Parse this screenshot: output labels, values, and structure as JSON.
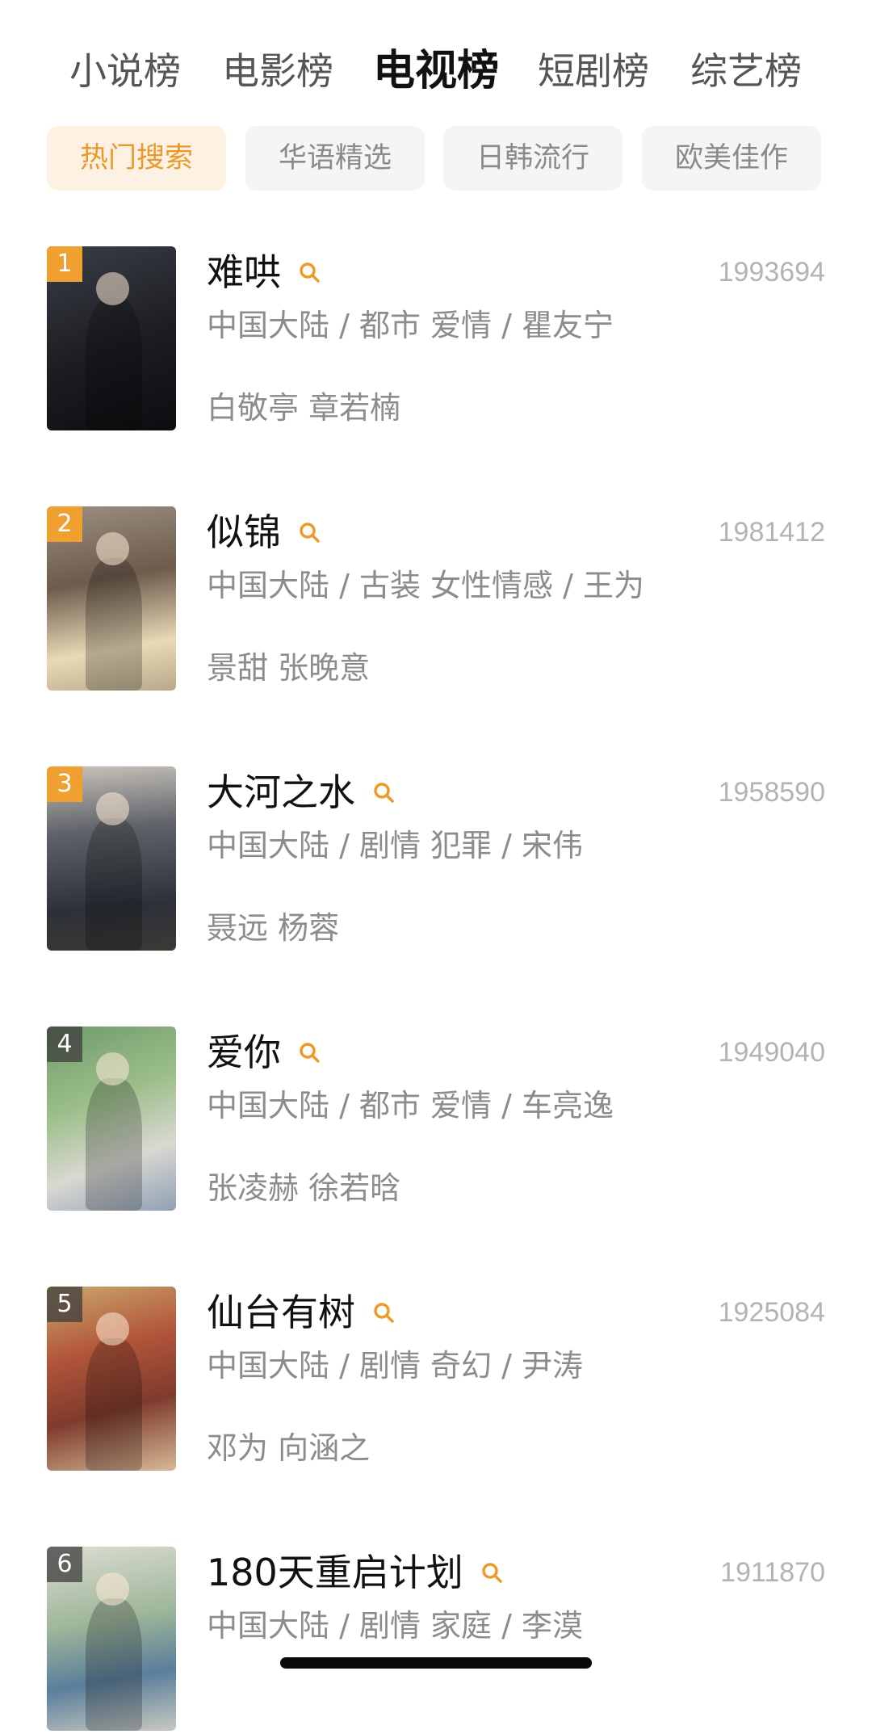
{
  "top_tabs": [
    {
      "label": "小说榜",
      "active": false
    },
    {
      "label": "电影榜",
      "active": false
    },
    {
      "label": "电视榜",
      "active": true
    },
    {
      "label": "短剧榜",
      "active": false
    },
    {
      "label": "综艺榜",
      "active": false
    }
  ],
  "filter_chips": [
    {
      "label": "热门搜索",
      "active": true
    },
    {
      "label": "华语精选",
      "active": false
    },
    {
      "label": "日韩流行",
      "active": false
    },
    {
      "label": "欧美佳作",
      "active": false
    }
  ],
  "colors": {
    "accent": "#f0a030",
    "chip_active_bg": "#fdf1e3",
    "chip_active_text": "#ea9a2a"
  },
  "items": [
    {
      "rank": "1",
      "title": "难哄",
      "score": "1993694",
      "meta": "中国大陆 / 都市 爱情 / 瞿友宁",
      "cast": "白敬亭 章若楠"
    },
    {
      "rank": "2",
      "title": "似锦",
      "score": "1981412",
      "meta": "中国大陆 / 古装 女性情感 / 王为",
      "cast": "景甜 张晚意"
    },
    {
      "rank": "3",
      "title": "大河之水",
      "score": "1958590",
      "meta": "中国大陆 / 剧情 犯罪 / 宋伟",
      "cast": "聂远 杨蓉"
    },
    {
      "rank": "4",
      "title": "爱你",
      "score": "1949040",
      "meta": "中国大陆 / 都市 爱情 / 车亮逸",
      "cast": "张凌赫 徐若晗"
    },
    {
      "rank": "5",
      "title": "仙台有树",
      "score": "1925084",
      "meta": "中国大陆 / 剧情 奇幻 / 尹涛",
      "cast": "邓为 向涵之"
    },
    {
      "rank": "6",
      "title": "180天重启计划",
      "score": "1911870",
      "meta": "中国大陆 / 剧情 家庭 / 李漠",
      "cast": ""
    }
  ]
}
